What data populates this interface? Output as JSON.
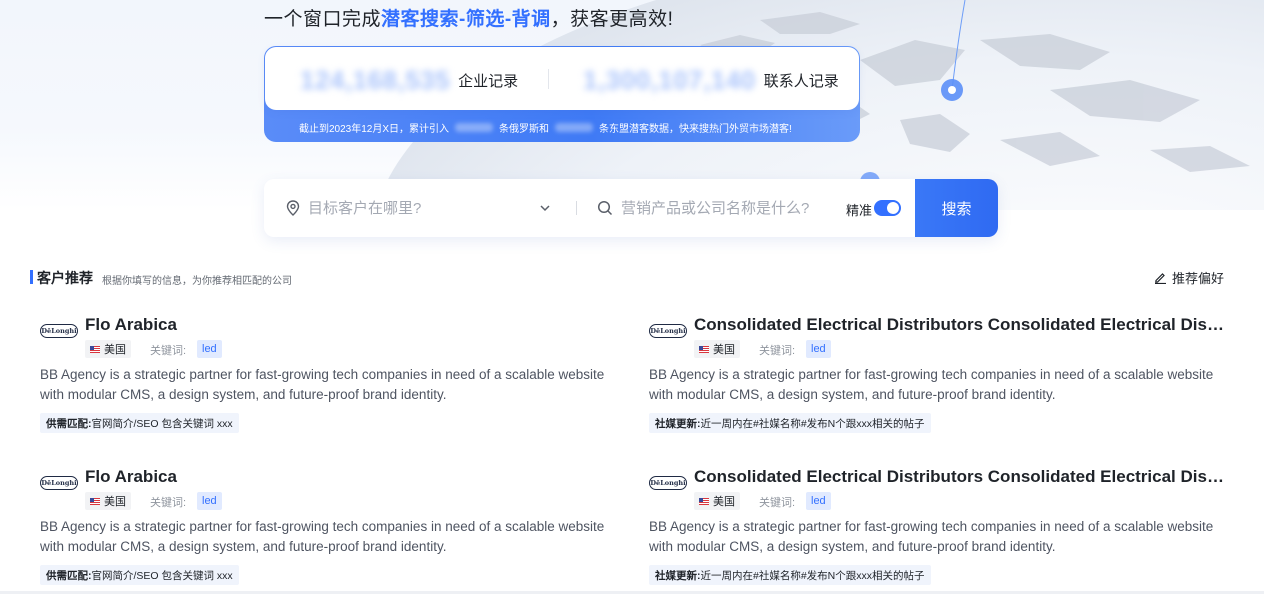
{
  "hero": {
    "headline_prefix": "一个窗口完成",
    "headline_highlight": "潜客搜索-筛选-背调",
    "headline_suffix": "，获客更高效!",
    "stats": [
      {
        "value": "124,168,535",
        "label": "企业记录"
      },
      {
        "value": "1,300,107,140",
        "label": "联系人记录"
      }
    ],
    "note_part1": "截止到2023年12月X日，累计引入",
    "note_part2": "条俄罗斯和",
    "note_part3": "条东盟潜客数据，快来搜热门外贸市场潜客!"
  },
  "search": {
    "location_placeholder": "目标客户在哪里?",
    "keyword_placeholder": "营销产品或公司名称是什么?",
    "precise_label": "精准",
    "precise_enabled": true,
    "button_label": "搜索"
  },
  "section": {
    "title": "客户推荐",
    "subtitle": "根据你填写的信息，为你推荐相匹配的公司",
    "preference_label": "推荐偏好"
  },
  "cards": [
    {
      "logo_text": "DēLonghi",
      "title": "Flo Arabica",
      "country": "美国",
      "keyword_label": "关键词:",
      "keyword": "led",
      "description": "BB Agency is a strategic partner for fast-growing tech companies in need of a scalable website with modular CMS, a design system, and future-proof brand identity.",
      "match_label": "供需匹配:",
      "match_text": "官网简介/SEO 包含关键词 xxx"
    },
    {
      "logo_text": "DēLonghi",
      "title": "Consolidated Electrical Distributors Consolidated Electrical Distributors",
      "country": "美国",
      "keyword_label": "关键词:",
      "keyword": "led",
      "description": "BB Agency is a strategic partner for fast-growing tech companies in need of a scalable website with modular CMS, a design system, and future-proof brand identity.",
      "match_label": "社媒更新:",
      "match_text": "近一周内在#社媒名称#发布N个跟xxx相关的帖子"
    },
    {
      "logo_text": "DēLonghi",
      "title": "Flo Arabica",
      "country": "美国",
      "keyword_label": "关键词:",
      "keyword": "led",
      "description": "BB Agency is a strategic partner for fast-growing tech companies in need of a scalable website with modular CMS, a design system, and future-proof brand identity.",
      "match_label": "供需匹配:",
      "match_text": "官网简介/SEO 包含关键词 xxx"
    },
    {
      "logo_text": "DēLonghi",
      "title": "Consolidated Electrical Distributors Consolidated Electrical Distributors",
      "country": "美国",
      "keyword_label": "关键词:",
      "keyword": "led",
      "description": "BB Agency is a strategic partner for fast-growing tech companies in need of a scalable website with modular CMS, a design system, and future-proof brand identity.",
      "match_label": "社媒更新:",
      "match_text": "近一周内在#社媒名称#发布N个跟xxx相关的帖子"
    }
  ],
  "colors": {
    "accent": "#3370ff",
    "text_primary": "#1f2329",
    "text_secondary": "#4e5461",
    "tag_bg": "#e1eaff"
  }
}
